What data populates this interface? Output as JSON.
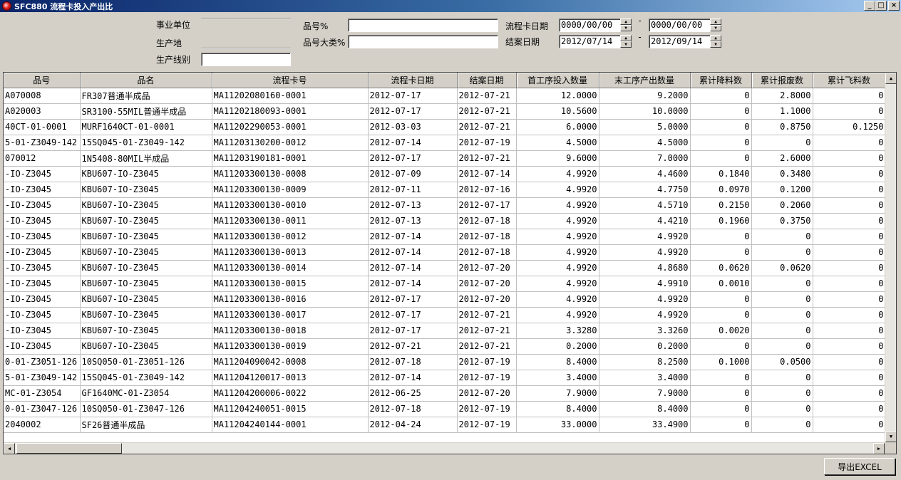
{
  "window": {
    "title": "SFC880 流程卡投入产出比",
    "minimize": "_",
    "maximize": "□",
    "close": "×"
  },
  "filters": {
    "unit_label": "事业单位",
    "place_label": "生产地",
    "line_label": "生产线别",
    "line_value": "",
    "part_label": "品号%",
    "part_value": "",
    "category_label": "品号大类%",
    "category_value": "",
    "card_date_label": "流程卡日期",
    "card_date_from": "0000/00/00",
    "card_date_to": "0000/00/00",
    "close_date_label": "结案日期",
    "close_date_from": "2012/07/14",
    "close_date_to": "2012/09/14",
    "range_sep": "-"
  },
  "table": {
    "columns": [
      "品号",
      "品名",
      "流程卡号",
      "流程卡日期",
      "结案日期",
      "首工序投入数量",
      "末工序产出数量",
      "累计降料数",
      "累计报废数",
      "累计飞料数"
    ],
    "rows": [
      [
        "A070008",
        "FR307普通半成品",
        "MA11202080160-0001",
        "2012-07-17",
        "2012-07-21",
        "12.0000",
        "9.2000",
        "0",
        "2.8000",
        "0"
      ],
      [
        "A020003",
        "SR3100-55MIL普通半成品",
        "MA11202180093-0001",
        "2012-07-17",
        "2012-07-21",
        "10.5600",
        "10.0000",
        "0",
        "1.1000",
        "0"
      ],
      [
        "40CT-01-0001",
        "MURF1640CT-01-0001",
        "MA11202290053-0001",
        "2012-03-03",
        "2012-07-21",
        "6.0000",
        "5.0000",
        "0",
        "0.8750",
        "0.1250"
      ],
      [
        "5-01-Z3049-142",
        "15SQ045-01-Z3049-142",
        "MA11203130200-0012",
        "2012-07-14",
        "2012-07-19",
        "4.5000",
        "4.5000",
        "0",
        "0",
        "0"
      ],
      [
        "070012",
        "1N5408-80MIL半成品",
        "MA11203190181-0001",
        "2012-07-17",
        "2012-07-21",
        "9.6000",
        "7.0000",
        "0",
        "2.6000",
        "0"
      ],
      [
        "-IO-Z3045",
        "KBU607-IO-Z3045",
        "MA11203300130-0008",
        "2012-07-09",
        "2012-07-14",
        "4.9920",
        "4.4600",
        "0.1840",
        "0.3480",
        "0"
      ],
      [
        "-IO-Z3045",
        "KBU607-IO-Z3045",
        "MA11203300130-0009",
        "2012-07-11",
        "2012-07-16",
        "4.9920",
        "4.7750",
        "0.0970",
        "0.1200",
        "0"
      ],
      [
        "-IO-Z3045",
        "KBU607-IO-Z3045",
        "MA11203300130-0010",
        "2012-07-13",
        "2012-07-17",
        "4.9920",
        "4.5710",
        "0.2150",
        "0.2060",
        "0"
      ],
      [
        "-IO-Z3045",
        "KBU607-IO-Z3045",
        "MA11203300130-0011",
        "2012-07-13",
        "2012-07-18",
        "4.9920",
        "4.4210",
        "0.1960",
        "0.3750",
        "0"
      ],
      [
        "-IO-Z3045",
        "KBU607-IO-Z3045",
        "MA11203300130-0012",
        "2012-07-14",
        "2012-07-18",
        "4.9920",
        "4.9920",
        "0",
        "0",
        "0"
      ],
      [
        "-IO-Z3045",
        "KBU607-IO-Z3045",
        "MA11203300130-0013",
        "2012-07-14",
        "2012-07-18",
        "4.9920",
        "4.9920",
        "0",
        "0",
        "0"
      ],
      [
        "-IO-Z3045",
        "KBU607-IO-Z3045",
        "MA11203300130-0014",
        "2012-07-14",
        "2012-07-20",
        "4.9920",
        "4.8680",
        "0.0620",
        "0.0620",
        "0"
      ],
      [
        "-IO-Z3045",
        "KBU607-IO-Z3045",
        "MA11203300130-0015",
        "2012-07-14",
        "2012-07-20",
        "4.9920",
        "4.9910",
        "0.0010",
        "0",
        "0"
      ],
      [
        "-IO-Z3045",
        "KBU607-IO-Z3045",
        "MA11203300130-0016",
        "2012-07-17",
        "2012-07-20",
        "4.9920",
        "4.9920",
        "0",
        "0",
        "0"
      ],
      [
        "-IO-Z3045",
        "KBU607-IO-Z3045",
        "MA11203300130-0017",
        "2012-07-17",
        "2012-07-21",
        "4.9920",
        "4.9920",
        "0",
        "0",
        "0"
      ],
      [
        "-IO-Z3045",
        "KBU607-IO-Z3045",
        "MA11203300130-0018",
        "2012-07-17",
        "2012-07-21",
        "3.3280",
        "3.3260",
        "0.0020",
        "0",
        "0"
      ],
      [
        "-IO-Z3045",
        "KBU607-IO-Z3045",
        "MA11203300130-0019",
        "2012-07-21",
        "2012-07-21",
        "0.2000",
        "0.2000",
        "0",
        "0",
        "0"
      ],
      [
        "0-01-Z3051-126",
        "10SQ050-01-Z3051-126",
        "MA11204090042-0008",
        "2012-07-18",
        "2012-07-19",
        "8.4000",
        "8.2500",
        "0.1000",
        "0.0500",
        "0"
      ],
      [
        "5-01-Z3049-142",
        "15SQ045-01-Z3049-142",
        "MA11204120017-0013",
        "2012-07-14",
        "2012-07-19",
        "3.4000",
        "3.4000",
        "0",
        "0",
        "0"
      ],
      [
        "MC-01-Z3054",
        "GF1640MC-01-Z3054",
        "MA11204200006-0022",
        "2012-06-25",
        "2012-07-20",
        "7.9000",
        "7.9000",
        "0",
        "0",
        "0"
      ],
      [
        "0-01-Z3047-126",
        "10SQ050-01-Z3047-126",
        "MA11204240051-0015",
        "2012-07-18",
        "2012-07-19",
        "8.4000",
        "8.4000",
        "0",
        "0",
        "0"
      ],
      [
        "2040002",
        "SF26普通半成品",
        "MA11204240144-0001",
        "2012-04-24",
        "2012-07-19",
        "33.0000",
        "33.4900",
        "0",
        "0",
        "0"
      ]
    ]
  },
  "scroll": {
    "up": "▲",
    "down": "▼",
    "left": "◀",
    "right": "▶"
  },
  "spin": {
    "up": "▲",
    "down": "▼"
  },
  "actions": {
    "export_label": "导出EXCEL"
  }
}
